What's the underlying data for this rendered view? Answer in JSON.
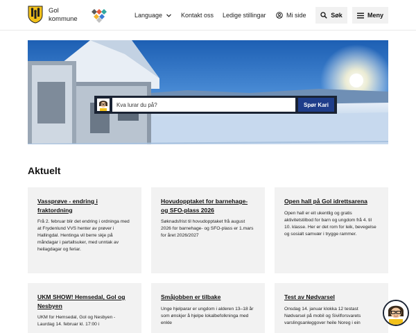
{
  "header": {
    "brand_line1": "Gol",
    "brand_line2": "kommune",
    "language": "Language",
    "contact": "Kontakt oss",
    "jobs": "Ledige stillingar",
    "mypage": "Mi side",
    "search": "Søk",
    "menu": "Meny"
  },
  "hero": {
    "search_placeholder": "Kva lurar du på?",
    "ask_button": "Spør Kari"
  },
  "news": {
    "title": "Aktuelt",
    "items": [
      {
        "title": "Vassprøve - endring i fraktordning",
        "text": "Frå 2. februar blir det endring i ordninga med at Frydenlund VVS henter av prøver i Hallingdal. Hentinga vil berre skje på måndagar i partallsuker, med unntak av heilagdagar og feriar."
      },
      {
        "title": "Hovudopptaket for barnehage- og SFO-plass 2026",
        "text": "Søknadsfrist til hovudopptaket frå august 2026 for barnehage- og SFO-plass er 1.mars for året 2026/2027"
      },
      {
        "title": "Open hall på Gol idrettsarena",
        "text": "Open hall er eit ukentlig og gratis aktivitetstilbod for barn og ungdom frå 4. til 10. klasse. Her er det rom for leik, bevegelse og sosialt samvær i trygge rammer."
      },
      {
        "title": "UKM SHOW! Hemsedal, Gol og Nesbyen",
        "text": "UKM for Hemsedal, Gol og Nesbyen - Laurdag 14. februar kl. 17:00 i"
      },
      {
        "title": "Småjobben er tilbake",
        "text": "Unge hjelparar er ungdom i alderen 13–18 år som ønskjer å hjelpe lokalbefolkninga med enkle"
      },
      {
        "title": "Test av Nødvarsel",
        "text": "Onsdag 14. januar klokka 12 testast Nødvarsel på mobil og Sivilforsvarets varslingsanleggover heile Noreg i ein"
      }
    ]
  }
}
